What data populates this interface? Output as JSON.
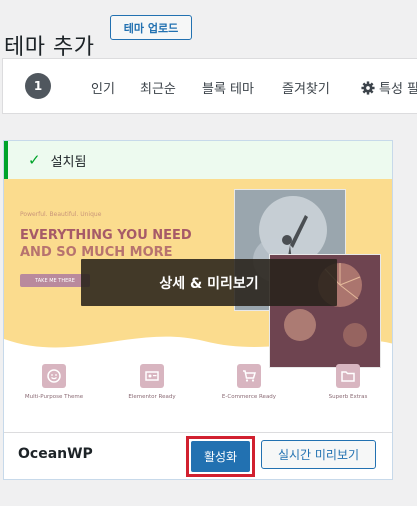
{
  "header": {
    "title": "테마 추가",
    "upload_button": "테마 업로드"
  },
  "filters": {
    "count": "1",
    "tabs": [
      {
        "label": "인기"
      },
      {
        "label": "최근순"
      },
      {
        "label": "블록 테마"
      },
      {
        "label": "즐겨찾기"
      },
      {
        "label": "특성 필"
      }
    ]
  },
  "theme_card": {
    "installed_label": "설치됨",
    "screenshot": {
      "tagline": "Powerful. Beautiful. Unique",
      "headline_1": "EVERYTHING YOU NEED",
      "headline_2": "AND SO MUCH MORE",
      "cta": "TAKE ME THERE",
      "features": [
        {
          "label": "Multi-Purpose Theme",
          "icon": "smiley-icon"
        },
        {
          "label": "Elementor Ready",
          "icon": "id-card-icon"
        },
        {
          "label": "E-Commerce Ready",
          "icon": "cart-icon"
        },
        {
          "label": "Superb Extras",
          "icon": "folder-icon"
        }
      ]
    },
    "details_overlay": "상세 & 미리보기",
    "name": "OceanWP",
    "activate_button": "활성화",
    "live_preview_button": "실시간 미리보기"
  },
  "colors": {
    "wp_blue": "#2271b1",
    "installed_green": "#00a32a",
    "highlight_red": "#d1202f",
    "hero_yellow": "#fbdc8e"
  }
}
